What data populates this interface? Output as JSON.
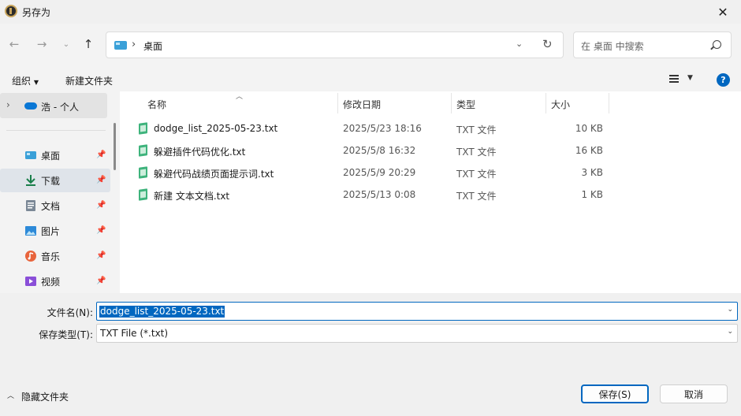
{
  "window": {
    "title": "另存为"
  },
  "address": {
    "location": "桌面"
  },
  "search": {
    "placeholder": "在 桌面 中搜索"
  },
  "toolbar": {
    "organize": "组织",
    "new_folder": "新建文件夹"
  },
  "sidebar": {
    "cloud_label": "浩 - 个人",
    "items": [
      {
        "label": "桌面",
        "icon": "desktop-icon",
        "pinned": true
      },
      {
        "label": "下载",
        "icon": "download-icon",
        "pinned": true,
        "active": true
      },
      {
        "label": "文档",
        "icon": "document-icon",
        "pinned": true
      },
      {
        "label": "图片",
        "icon": "picture-icon",
        "pinned": true
      },
      {
        "label": "音乐",
        "icon": "music-icon",
        "pinned": true
      },
      {
        "label": "视频",
        "icon": "video-icon",
        "pinned": true
      }
    ]
  },
  "columns": {
    "name": "名称",
    "modified": "修改日期",
    "type": "类型",
    "size": "大小"
  },
  "files": [
    {
      "name": "dodge_list_2025-05-23.txt",
      "modified": "2025/5/23 18:16",
      "type": "TXT 文件",
      "size": "10 KB"
    },
    {
      "name": "躲避插件代码优化.txt",
      "modified": "2025/5/8 16:32",
      "type": "TXT 文件",
      "size": "16 KB"
    },
    {
      "name": "躲避代码战绩页面提示词.txt",
      "modified": "2025/5/9 20:29",
      "type": "TXT 文件",
      "size": "3 KB"
    },
    {
      "name": "新建 文本文档.txt",
      "modified": "2025/5/13 0:08",
      "type": "TXT 文件",
      "size": "1 KB"
    }
  ],
  "form": {
    "filename_label": "文件名(N):",
    "filename_value": "dodge_list_2025-05-23.txt",
    "filetype_label": "保存类型(T):",
    "filetype_value": "TXT File (*.txt)"
  },
  "footer": {
    "hide_folders": "隐藏文件夹",
    "save": "保存(S)",
    "cancel": "取消"
  },
  "colors": {
    "accent": "#0067c0",
    "file_icon": "#3eb37c",
    "cloud": "#0a77d5"
  }
}
